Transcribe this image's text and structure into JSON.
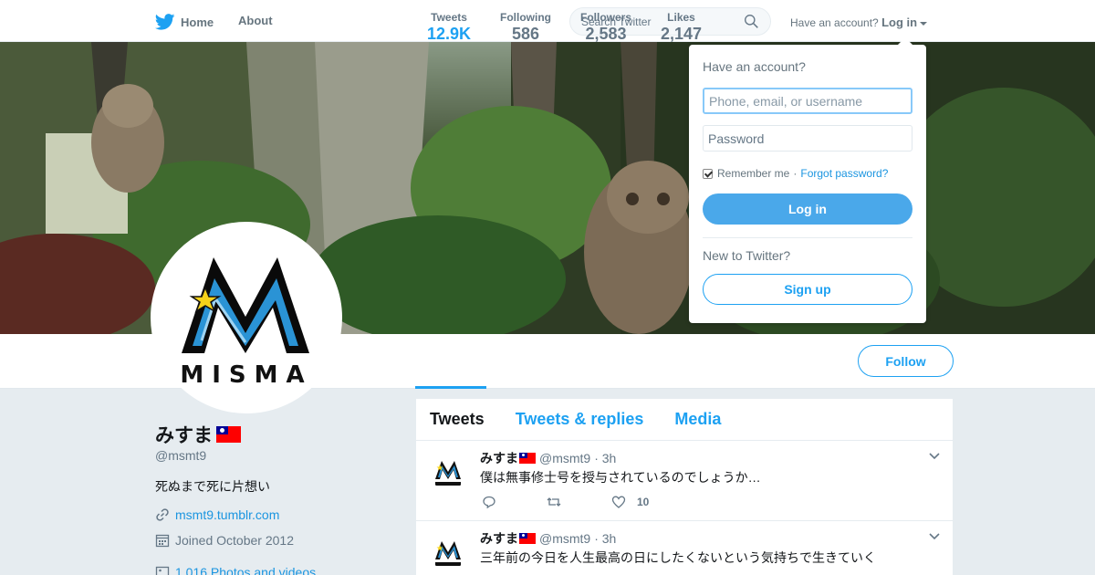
{
  "nav": {
    "home": "Home",
    "about": "About",
    "search_placeholder": "Search Twitter",
    "account_prompt": "Have an account?",
    "login_link": "Log in"
  },
  "profile": {
    "display_name": "みすま",
    "screen_name": "@msmt9",
    "bio": "死ぬまで死に片想い",
    "url": "msmt9.tumblr.com",
    "joined": "Joined October 2012",
    "photos": "1,016 Photos and videos",
    "avatar_text": "MISMA"
  },
  "stats": [
    {
      "label": "Tweets",
      "value": "12.9K"
    },
    {
      "label": "Following",
      "value": "586"
    },
    {
      "label": "Followers",
      "value": "2,583"
    },
    {
      "label": "Likes",
      "value": "2,147"
    }
  ],
  "follow_button": "Follow",
  "timeline": {
    "tabs": [
      "Tweets",
      "Tweets & replies",
      "Media"
    ],
    "tweets": [
      {
        "name": "みすま",
        "handle": "@msmt9",
        "time": "· 3h",
        "text": "僕は無事修士号を授与されているのでしょうか…",
        "likes": "10"
      },
      {
        "name": "みすま",
        "handle": "@msmt9",
        "time": "· 3h",
        "text": "三年前の今日を人生最高の日にしたくないという気持ちで生きていく",
        "likes": ""
      }
    ]
  },
  "login_dropdown": {
    "title": "Have an account?",
    "username_placeholder": "Phone, email, or username",
    "password_placeholder": "Password",
    "remember": "Remember me",
    "separator": "·",
    "forgot": "Forgot password?",
    "login_button": "Log in",
    "new_prompt": "New to Twitter?",
    "signup_button": "Sign up"
  },
  "colors": {
    "accent": "#1da1f2",
    "background": "#e6ecf0",
    "login_button": "#4aa8ea"
  }
}
